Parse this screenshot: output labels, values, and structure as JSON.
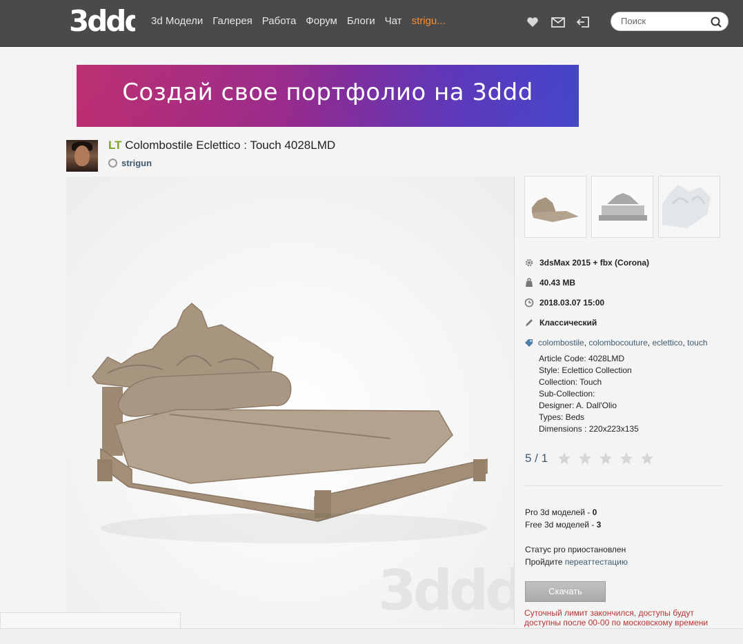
{
  "header": {
    "logo_text": "3ddd",
    "nav": [
      "3d Модели",
      "Галерея",
      "Работа",
      "Форум",
      "Блоги",
      "Чат"
    ],
    "user_link": "strigu...",
    "icons": [
      "heart-icon",
      "mail-icon",
      "logout-icon"
    ],
    "search": {
      "placeholder": "Поиск"
    }
  },
  "banner": {
    "text": "Создай свое портфолио на 3ddd"
  },
  "model": {
    "prefix": "LT",
    "title": "Colombostile Eclettico : Touch 4028LMD",
    "author": "strigun"
  },
  "main_image": {
    "watermark": "3ddd"
  },
  "info": {
    "software": "3dsMax 2015 + fbx (Corona)",
    "size": "40.43 MB",
    "date": "2018.03.07 15:00",
    "style": "Классический",
    "tags": [
      "colombostile",
      "colombocouture",
      "eclettico",
      "touch"
    ]
  },
  "description": [
    "Article Code: 4028LMD",
    "Style: Eclettico Collection",
    "Collection: Touch",
    "Sub-Collection:",
    "Designer: A. Dall'Olio",
    "Types: Beds",
    "Dimensions : 220x223x135"
  ],
  "rating": {
    "text": "5 / 1",
    "stars_total": 5,
    "stars_filled": 0
  },
  "stats": {
    "pro_label": "Pro 3d моделей - ",
    "pro_value": "0",
    "free_label": "Free 3d моделей - ",
    "free_value": "3"
  },
  "status": {
    "line1": "Статус pro приостановлен",
    "line2_prefix": "Пройдите ",
    "line2_link": "переаттестацию"
  },
  "download_label": "Скачать",
  "limit_text": "Суточный лимит закончился, доступы будут доступны после 00-00 по московскому времени",
  "colors": {
    "topbar": "#4a4a4a",
    "user_link": "#ff8a2a",
    "accent_green": "#7aa628",
    "link": "#3e5a6e",
    "warning": "#b83232"
  }
}
